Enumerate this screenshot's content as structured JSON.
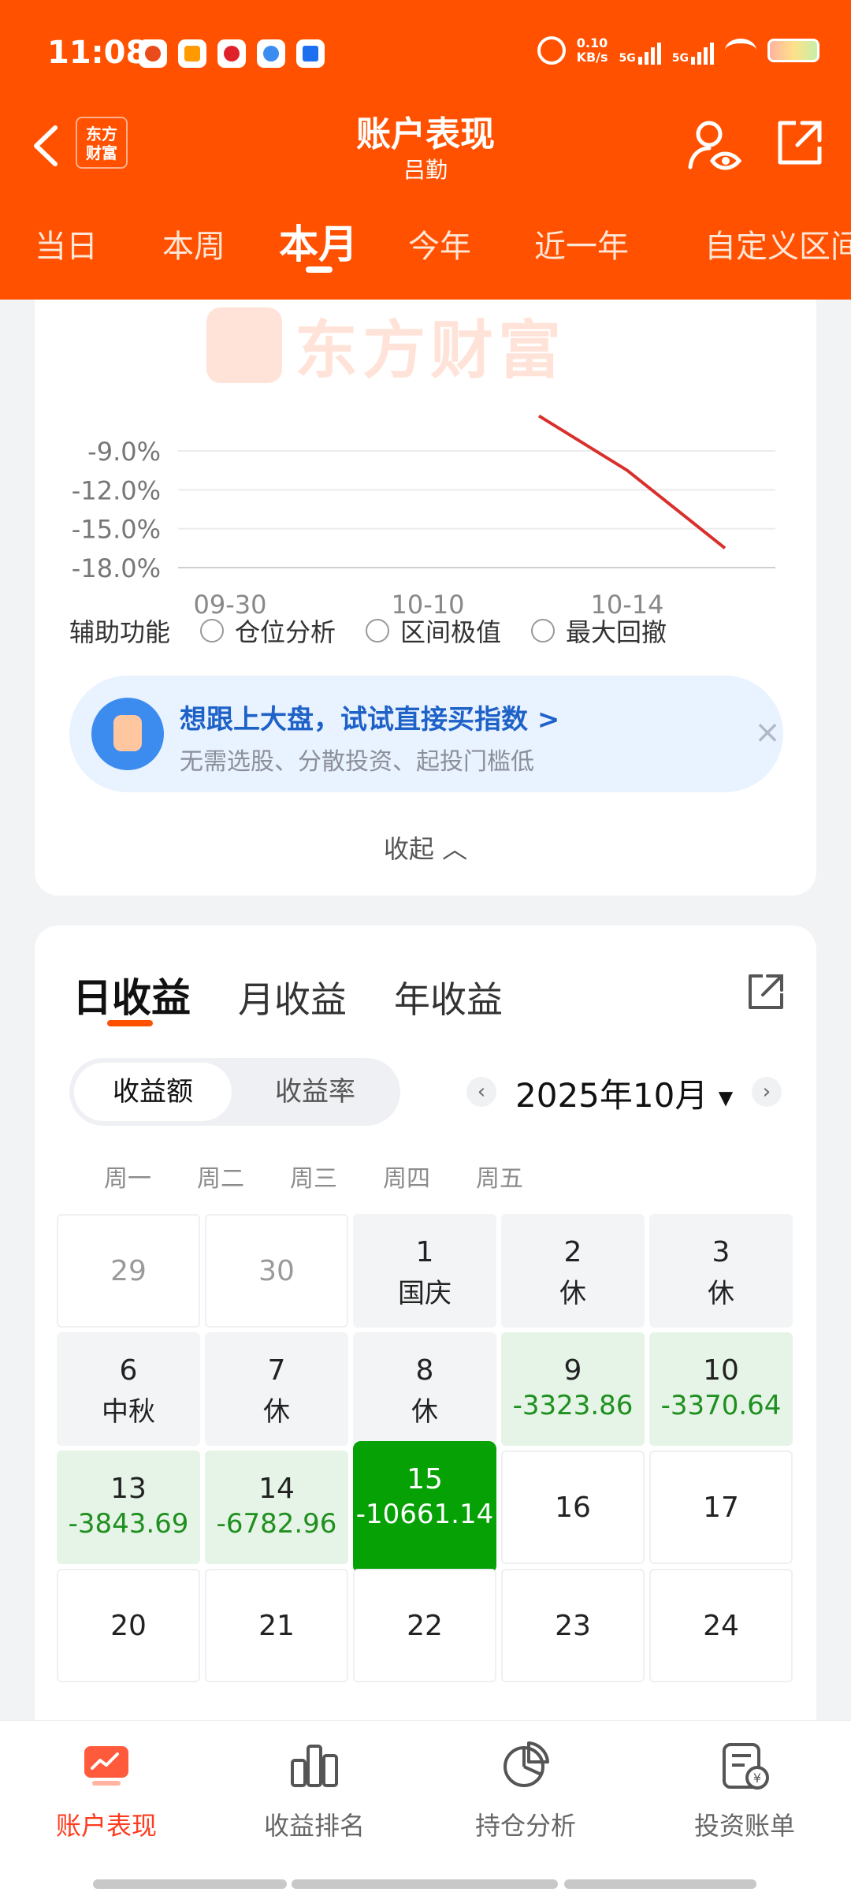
{
  "status_bar": {
    "time": "11:08",
    "speed": "0.10",
    "speed_unit": "KB/s",
    "sig1": "5G",
    "sig2": "5G"
  },
  "header": {
    "logo_line1": "东方",
    "logo_line2": "财富",
    "title": "账户表现",
    "subtitle": "吕勤"
  },
  "tabs": [
    "当日",
    "本周",
    "本月",
    "今年",
    "近一年",
    "自定义区间"
  ],
  "active_tab_index": 2,
  "chart": {
    "watermark": "东方财富",
    "y_ticks": [
      "-9.0%",
      "-12.0%",
      "-15.0%",
      "-18.0%"
    ],
    "x_ticks": [
      "09-30",
      "10-10",
      "10-14"
    ]
  },
  "chart_data": {
    "type": "line",
    "x": [
      "10-13",
      "10-14",
      "10-15"
    ],
    "y": [
      -6.3,
      -10.5,
      -16.5
    ],
    "series": [
      {
        "x": [
          "10-13",
          "10-14",
          "10-15"
        ],
        "values": [
          -6.3,
          -10.5,
          -16.5
        ],
        "color": "#d9302c"
      }
    ],
    "ylim": [
      -18.0,
      -6.0
    ],
    "y_tick_labels": [
      "-9.0%",
      "-12.0%",
      "-15.0%",
      "-18.0%"
    ],
    "x_tick_labels": [
      "09-30",
      "10-10",
      "10-14"
    ],
    "grid": true
  },
  "aux": {
    "label": "辅助功能",
    "options": [
      "仓位分析",
      "区间极值",
      "最大回撤"
    ]
  },
  "promo": {
    "title": "想跟上大盘，试试直接买指数 >",
    "subtitle": "无需选股、分散投资、起投门槛低",
    "close": "×"
  },
  "collapse_label": "收起 ︿",
  "calendar": {
    "tabs": [
      "日收益",
      "月收益",
      "年收益"
    ],
    "segments": [
      "收益额",
      "收益率"
    ],
    "month": "2025年10月",
    "prev": "‹",
    "next": "›",
    "weekdays": [
      "周一",
      "周二",
      "周三",
      "周四",
      "周五"
    ],
    "rows": [
      [
        {
          "d": "29",
          "s": "",
          "t": "muted"
        },
        {
          "d": "30",
          "s": "",
          "t": "muted"
        },
        {
          "d": "1",
          "s": "国庆",
          "t": "holiday"
        },
        {
          "d": "2",
          "s": "休",
          "t": "holiday"
        },
        {
          "d": "3",
          "s": "休",
          "t": "holiday"
        }
      ],
      [
        {
          "d": "6",
          "s": "中秋",
          "t": "holiday"
        },
        {
          "d": "7",
          "s": "休",
          "t": "holiday"
        },
        {
          "d": "8",
          "s": "休",
          "t": "holiday"
        },
        {
          "d": "9",
          "s": "-3323.86",
          "t": "loss"
        },
        {
          "d": "10",
          "s": "-3370.64",
          "t": "loss"
        }
      ],
      [
        {
          "d": "13",
          "s": "-3843.69",
          "t": "loss"
        },
        {
          "d": "14",
          "s": "-6782.96",
          "t": "loss"
        },
        {
          "d": "15",
          "s": "-10661.14",
          "t": "today"
        },
        {
          "d": "16",
          "s": "",
          "t": "plain"
        },
        {
          "d": "17",
          "s": "",
          "t": "plain"
        }
      ],
      [
        {
          "d": "20",
          "s": "",
          "t": "plain"
        },
        {
          "d": "21",
          "s": "",
          "t": "plain"
        },
        {
          "d": "22",
          "s": "",
          "t": "plain"
        },
        {
          "d": "23",
          "s": "",
          "t": "plain"
        },
        {
          "d": "24",
          "s": "",
          "t": "plain"
        }
      ]
    ]
  },
  "bottom_nav": [
    {
      "label": "账户表现",
      "icon": "chart-screen-icon",
      "active": true
    },
    {
      "label": "收益排名",
      "icon": "bar-ranking-icon",
      "active": false
    },
    {
      "label": "持仓分析",
      "icon": "pie-chart-icon",
      "active": false
    },
    {
      "label": "投资账单",
      "icon": "bill-icon",
      "active": false
    }
  ],
  "colors": {
    "brand": "#ff5100",
    "loss_green": "#05a105",
    "line_red": "#d9302c",
    "promo_blue": "#1e62c8"
  }
}
